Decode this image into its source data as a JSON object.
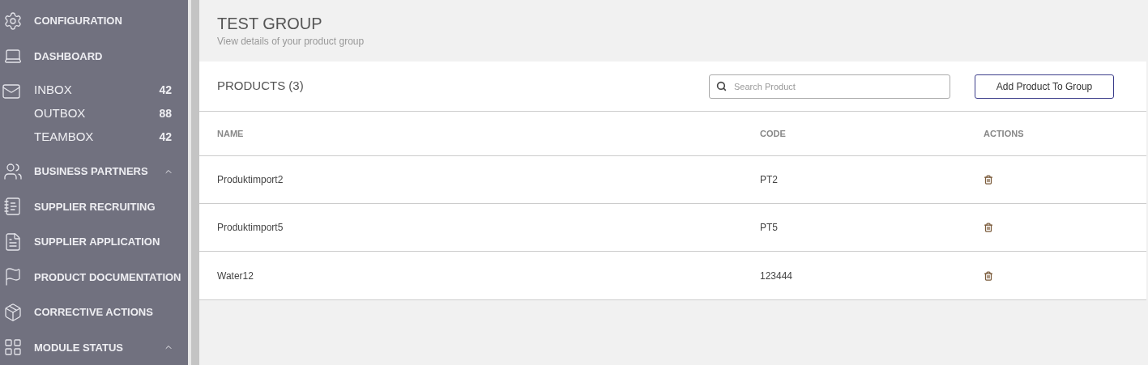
{
  "sidebar": {
    "items": [
      {
        "kind": "nav",
        "label": "CONFIGURATION"
      },
      {
        "kind": "nav",
        "label": "DASHBOARD"
      },
      {
        "kind": "mail",
        "children": [
          {
            "label": "INBOX",
            "count": "42"
          },
          {
            "label": "OUTBOX",
            "count": "88"
          },
          {
            "label": "TEAMBOX",
            "count": "42"
          }
        ]
      },
      {
        "kind": "nav",
        "label": "BUSINESS PARTNERS",
        "expanded": true
      },
      {
        "kind": "nav",
        "label": "SUPPLIER RECRUITING"
      },
      {
        "kind": "nav",
        "label": "SUPPLIER APPLICATION"
      },
      {
        "kind": "nav",
        "label": "PRODUCT DOCUMENTATION"
      },
      {
        "kind": "nav",
        "label": "CORRECTIVE ACTIONS"
      },
      {
        "kind": "nav",
        "label": "MODULE STATUS",
        "expanded": true
      }
    ]
  },
  "page": {
    "title": "TEST GROUP",
    "subtitle": "View details of your product group"
  },
  "products": {
    "heading": "PRODUCTS (3)",
    "search": {
      "placeholder": "Search Product"
    },
    "add_button": "Add Product To Group",
    "table": {
      "columns": [
        "NAME",
        "CODE",
        "ACTIONS"
      ],
      "rows": [
        {
          "name": "Produktimport2",
          "code": "PT2"
        },
        {
          "name": "Produktimport5",
          "code": "PT5"
        },
        {
          "name": "Water12",
          "code": "123444"
        }
      ]
    }
  }
}
